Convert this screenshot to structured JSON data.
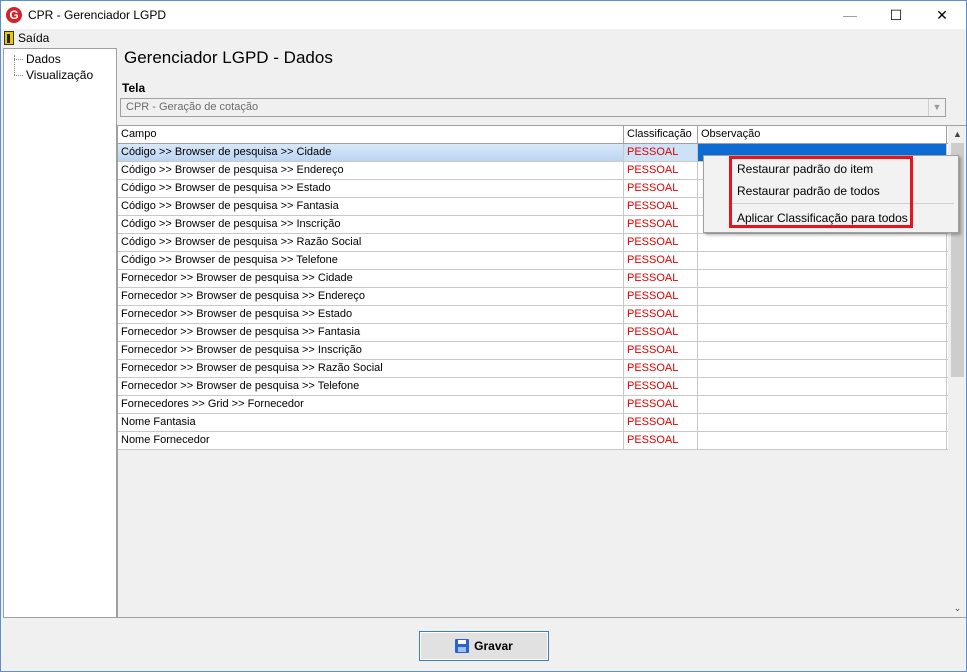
{
  "window": {
    "title": "CPR - Gerenciador LGPD",
    "controls": {
      "minimize": "—",
      "maximize": "☐",
      "close": "✕"
    }
  },
  "menu": {
    "exit_label": "Saída"
  },
  "tree": {
    "items": [
      {
        "label": "Dados"
      },
      {
        "label": "Visualização"
      }
    ]
  },
  "page": {
    "title": "Gerenciador LGPD - Dados"
  },
  "tela": {
    "label": "Tela",
    "value": "CPR - Geração de cotação"
  },
  "grid": {
    "columns": [
      "Campo",
      "Classificação",
      "Observação"
    ],
    "rows": [
      {
        "campo": "Código >> Browser de pesquisa >> Cidade",
        "classificacao": "PESSOAL",
        "observacao": ""
      },
      {
        "campo": "Código >> Browser de pesquisa >> Endereço",
        "classificacao": "PESSOAL",
        "observacao": ""
      },
      {
        "campo": "Código >> Browser de pesquisa >> Estado",
        "classificacao": "PESSOAL",
        "observacao": ""
      },
      {
        "campo": "Código >> Browser de pesquisa >> Fantasia",
        "classificacao": "PESSOAL",
        "observacao": ""
      },
      {
        "campo": "Código >> Browser de pesquisa >> Inscrição",
        "classificacao": "PESSOAL",
        "observacao": ""
      },
      {
        "campo": "Código >> Browser de pesquisa >> Razão Social",
        "classificacao": "PESSOAL",
        "observacao": ""
      },
      {
        "campo": "Código >> Browser de pesquisa >> Telefone",
        "classificacao": "PESSOAL",
        "observacao": ""
      },
      {
        "campo": "Fornecedor >> Browser de pesquisa >> Cidade",
        "classificacao": "PESSOAL",
        "observacao": ""
      },
      {
        "campo": "Fornecedor >> Browser de pesquisa >> Endereço",
        "classificacao": "PESSOAL",
        "observacao": ""
      },
      {
        "campo": "Fornecedor >> Browser de pesquisa >> Estado",
        "classificacao": "PESSOAL",
        "observacao": ""
      },
      {
        "campo": "Fornecedor >> Browser de pesquisa >> Fantasia",
        "classificacao": "PESSOAL",
        "observacao": ""
      },
      {
        "campo": "Fornecedor >> Browser de pesquisa >> Inscrição",
        "classificacao": "PESSOAL",
        "observacao": ""
      },
      {
        "campo": "Fornecedor >> Browser de pesquisa >> Razão Social",
        "classificacao": "PESSOAL",
        "observacao": ""
      },
      {
        "campo": "Fornecedor >> Browser de pesquisa >> Telefone",
        "classificacao": "PESSOAL",
        "observacao": ""
      },
      {
        "campo": "Fornecedores >> Grid >> Fornecedor",
        "classificacao": "PESSOAL",
        "observacao": ""
      },
      {
        "campo": "Nome Fantasia",
        "classificacao": "PESSOAL",
        "observacao": ""
      },
      {
        "campo": "Nome Fornecedor",
        "classificacao": "PESSOAL",
        "observacao": ""
      }
    ],
    "selected_row": 0
  },
  "context_menu": {
    "items": [
      {
        "label": "Restaurar padrão do item"
      },
      {
        "label": "Restaurar padrão de todos"
      },
      {
        "label": "Aplicar Classificação para todos"
      }
    ]
  },
  "footer": {
    "save_label": "Gravar"
  },
  "colors": {
    "classification_text": "#e00000",
    "selection": "#0d6bd6",
    "highlight_box": "#e8141d"
  }
}
